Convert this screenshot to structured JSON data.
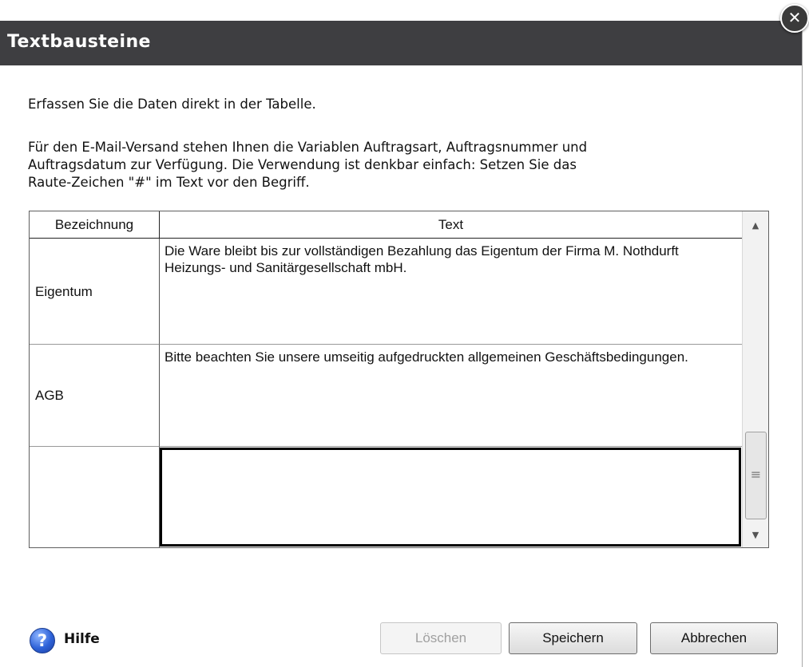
{
  "window": {
    "title": "Textbausteine",
    "close_glyph": "✕"
  },
  "intro": {
    "line1": "Erfassen Sie die Daten direkt in der Tabelle.",
    "line2": "Für den E-Mail-Versand stehen Ihnen die Variablen Auftragsart, Auftragsnummer und\nAuftragsdatum zur Verfügung. Die Verwendung ist denkbar einfach: Setzen Sie das\nRaute-Zeichen \"#\" im Text vor den Begriff."
  },
  "table": {
    "columns": [
      "Bezeichnung",
      "Text"
    ],
    "rows": [
      {
        "name": "Eigentum",
        "text": "Die Ware bleibt bis zur vollständigen Bezahlung das Eigentum der Firma M. Nothdurft Heizungs- und Sanitärgesellschaft mbH."
      },
      {
        "name": "AGB",
        "text": "Bitte beachten Sie unsere umseitig aufgedruckten allgemeinen Geschäftsbedingungen."
      },
      {
        "name": "",
        "text": ""
      }
    ],
    "scroll": {
      "up": "▲",
      "down": "▼",
      "grip": "≡"
    }
  },
  "footer": {
    "help_glyph": "?",
    "help_label": "Hilfe",
    "delete_label": "Löschen",
    "save_label": "Speichern",
    "cancel_label": "Abbrechen"
  },
  "colors": {
    "titlebar": "#3e3e41",
    "grid_border": "#5f5f5f"
  },
  "icons": [
    "close-icon",
    "help-icon",
    "scroll-up-arrow-icon",
    "scroll-down-arrow-icon"
  ]
}
